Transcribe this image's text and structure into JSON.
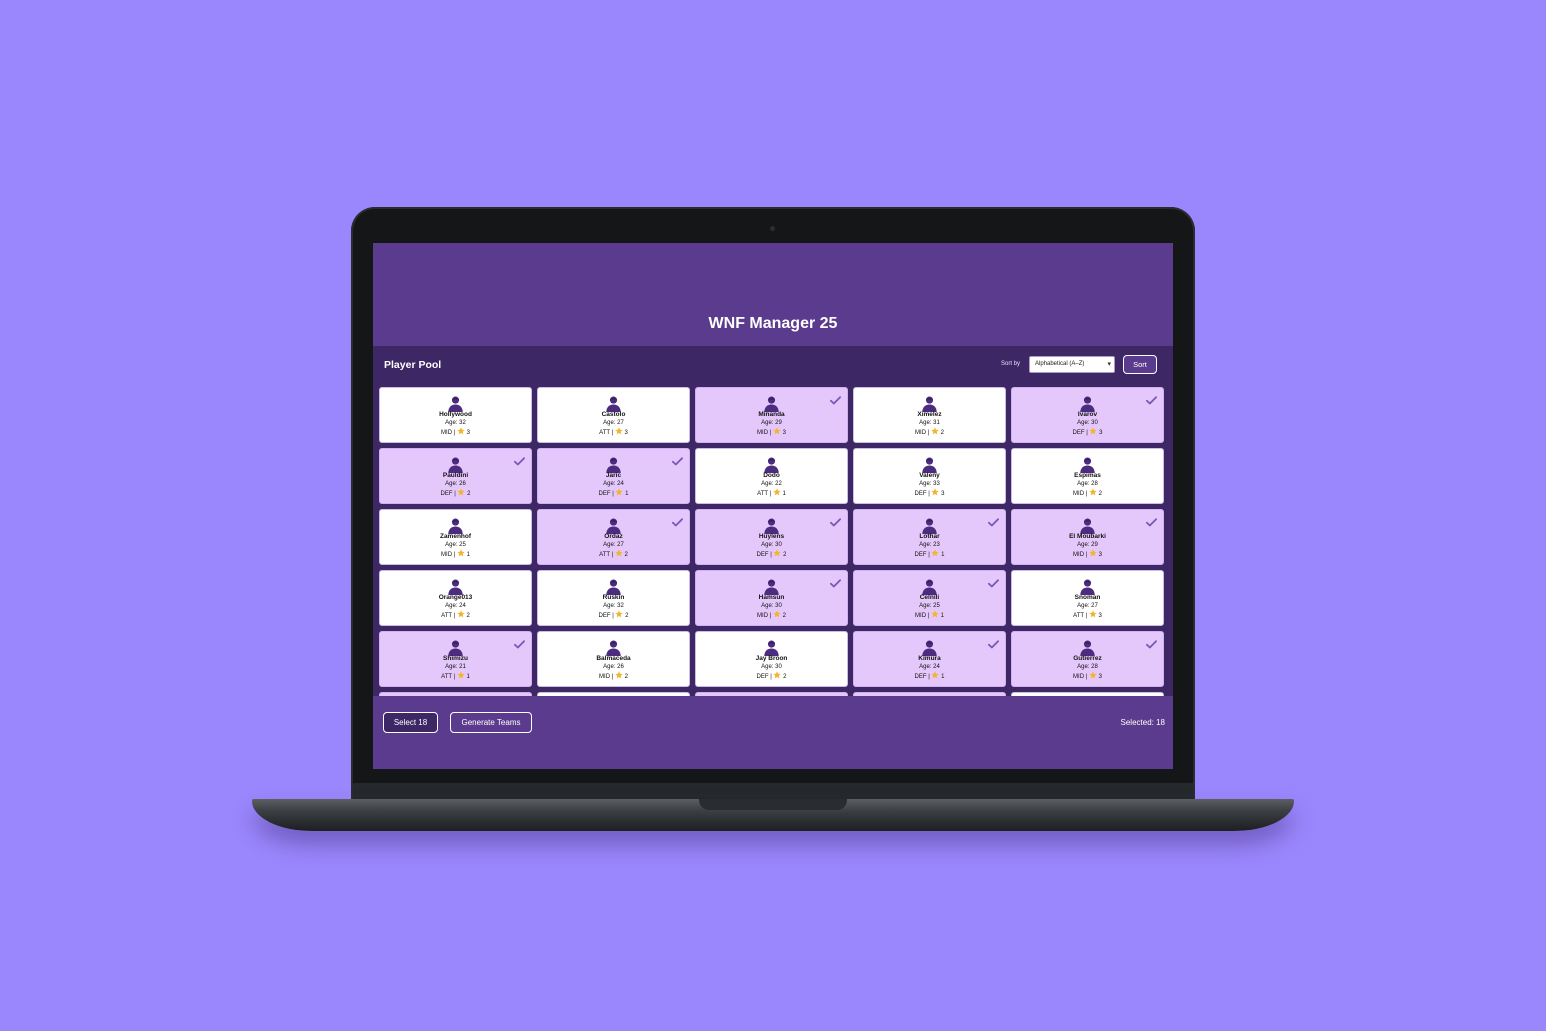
{
  "app": {
    "title": "WNF Manager 25"
  },
  "pool": {
    "title": "Player Pool",
    "sort_label": "Sort by",
    "sort_value": "Alphabetical (A–Z)",
    "sort_button": "Sort"
  },
  "colors": {
    "background": "#9b87fd",
    "header": "#5a3b8d",
    "pool": "#3d2765",
    "selected_card": "#e5c8fb",
    "star": "#f2b530",
    "avatar": "#4c2c7e"
  },
  "players": [
    {
      "name": "Hollywood",
      "age": "Age: 32",
      "meta": "MID | ",
      "stars": "3",
      "selected": false
    },
    {
      "name": "Castolo",
      "age": "Age: 27",
      "meta": "ATT | ",
      "stars": "3",
      "selected": false
    },
    {
      "name": "Minanda",
      "age": "Age: 29",
      "meta": "MID | ",
      "stars": "3",
      "selected": true
    },
    {
      "name": "Ximelez",
      "age": "Age: 31",
      "meta": "MID | ",
      "stars": "2",
      "selected": false
    },
    {
      "name": "Ivarov",
      "age": "Age: 30",
      "meta": "DEF | ",
      "stars": "3",
      "selected": true
    },
    {
      "name": "Pauldini",
      "age": "Age: 26",
      "meta": "DEF | ",
      "stars": "2",
      "selected": true
    },
    {
      "name": "Jaric",
      "age": "Age: 24",
      "meta": "DEF | ",
      "stars": "1",
      "selected": true
    },
    {
      "name": "Dodo",
      "age": "Age: 22",
      "meta": "ATT | ",
      "stars": "1",
      "selected": false
    },
    {
      "name": "Valeny",
      "age": "Age: 33",
      "meta": "DEF | ",
      "stars": "3",
      "selected": false
    },
    {
      "name": "Espimas",
      "age": "Age: 28",
      "meta": "MID | ",
      "stars": "2",
      "selected": false
    },
    {
      "name": "Zamenhof",
      "age": "Age: 25",
      "meta": "MID | ",
      "stars": "1",
      "selected": false
    },
    {
      "name": "Ordaz",
      "age": "Age: 27",
      "meta": "ATT | ",
      "stars": "2",
      "selected": true
    },
    {
      "name": "Huylens",
      "age": "Age: 30",
      "meta": "DEF | ",
      "stars": "2",
      "selected": true
    },
    {
      "name": "Lothar",
      "age": "Age: 23",
      "meta": "DEF | ",
      "stars": "1",
      "selected": true
    },
    {
      "name": "El Moubarki",
      "age": "Age: 29",
      "meta": "MID | ",
      "stars": "3",
      "selected": true
    },
    {
      "name": "Orange013",
      "age": "Age: 24",
      "meta": "ATT | ",
      "stars": "2",
      "selected": false
    },
    {
      "name": "Ruskin",
      "age": "Age: 32",
      "meta": "DEF | ",
      "stars": "2",
      "selected": false
    },
    {
      "name": "Hamsun",
      "age": "Age: 30",
      "meta": "MID | ",
      "stars": "2",
      "selected": true
    },
    {
      "name": "Celnili",
      "age": "Age: 25",
      "meta": "MID | ",
      "stars": "1",
      "selected": true
    },
    {
      "name": "Snoman",
      "age": "Age: 27",
      "meta": "ATT | ",
      "stars": "3",
      "selected": false
    },
    {
      "name": "Shimizu",
      "age": "Age: 21",
      "meta": "ATT | ",
      "stars": "1",
      "selected": true
    },
    {
      "name": "Balmaceda",
      "age": "Age: 26",
      "meta": "MID | ",
      "stars": "2",
      "selected": false
    },
    {
      "name": "Jay Broon",
      "age": "Age: 30",
      "meta": "DEF | ",
      "stars": "2",
      "selected": false
    },
    {
      "name": "Kimura",
      "age": "Age: 24",
      "meta": "DEF | ",
      "stars": "1",
      "selected": true
    },
    {
      "name": "Gutierrez",
      "age": "Age: 28",
      "meta": "MID | ",
      "stars": "3",
      "selected": true
    },
    {
      "name": "",
      "age": "",
      "meta": "",
      "stars": "",
      "selected": true
    },
    {
      "name": "",
      "age": "",
      "meta": "",
      "stars": "",
      "selected": false
    },
    {
      "name": "",
      "age": "",
      "meta": "",
      "stars": "",
      "selected": true
    },
    {
      "name": "",
      "age": "",
      "meta": "",
      "stars": "",
      "selected": true
    },
    {
      "name": "",
      "age": "",
      "meta": "",
      "stars": "",
      "selected": false
    }
  ],
  "footer": {
    "select_button": "Select 18",
    "generate_button": "Generate Teams",
    "selected_count": "Selected: 18"
  },
  "icons": {
    "avatar": "person-silhouette-icon",
    "rating": "star-icon",
    "selected": "checkmark-icon",
    "dropdown": "chevron-down-icon"
  }
}
